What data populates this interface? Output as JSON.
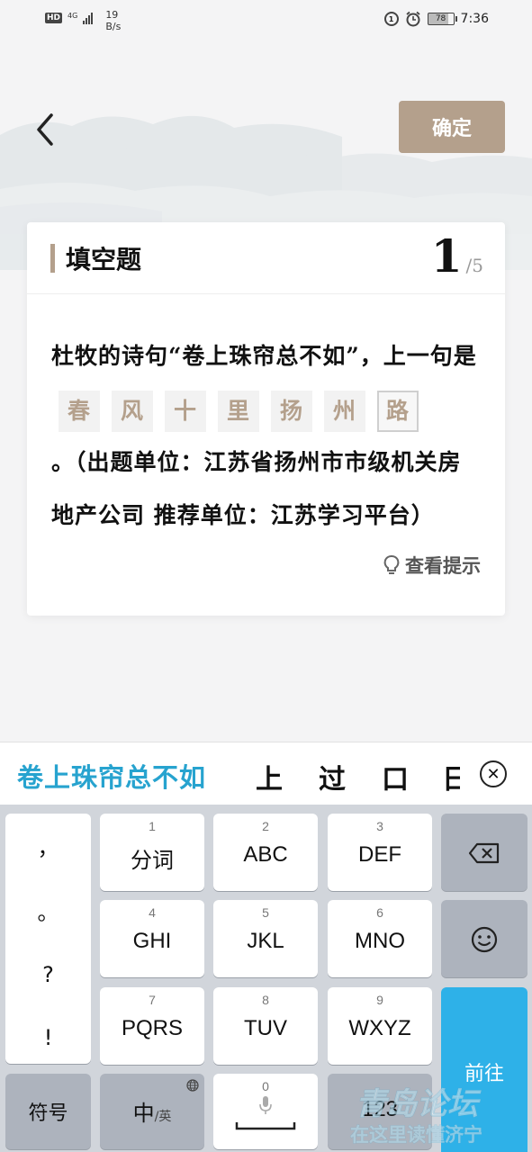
{
  "status_bar": {
    "hd": "HD",
    "network": "4G",
    "speed_value": "19",
    "speed_unit": "B/s",
    "battery": "78",
    "time": "7:36"
  },
  "header": {
    "confirm_label": "确定"
  },
  "card": {
    "type_title": "填空题",
    "progress_current": "1",
    "progress_total": "/5",
    "question_before": "杜牧的诗句“卷上珠帘总不如”，上一句是",
    "blanks": [
      "春",
      "风",
      "十",
      "里",
      "扬",
      "州",
      "路"
    ],
    "question_after": "。（出题单位：江苏省扬州市市级机关房地产公司 推荐单位：江苏学习平台）",
    "hint_label": "查看提示"
  },
  "ime": {
    "composition": "卷上珠帘总不如",
    "candidates": [
      "上",
      "过",
      "口",
      "日"
    ]
  },
  "keyboard": {
    "punctuation": [
      "，",
      "。",
      "?",
      "!"
    ],
    "keys": [
      {
        "num": "1",
        "label": "分词"
      },
      {
        "num": "2",
        "label": "ABC"
      },
      {
        "num": "3",
        "label": "DEF"
      },
      {
        "num": "4",
        "label": "GHI"
      },
      {
        "num": "5",
        "label": "JKL"
      },
      {
        "num": "6",
        "label": "MNO"
      },
      {
        "num": "7",
        "label": "PQRS"
      },
      {
        "num": "8",
        "label": "TUV"
      },
      {
        "num": "9",
        "label": "WXYZ"
      }
    ],
    "go_label": "前往",
    "symbol_label": "符号",
    "lang_main": "中",
    "lang_sub": "/英",
    "space_num": "0",
    "num_label": "123"
  },
  "watermark": {
    "line1": "青岛论坛",
    "line2": "在这里读懂济宁"
  },
  "colors": {
    "accent": "#b4a08c",
    "ime_blue": "#27a3cf",
    "go_key": "#2eb1e8"
  }
}
